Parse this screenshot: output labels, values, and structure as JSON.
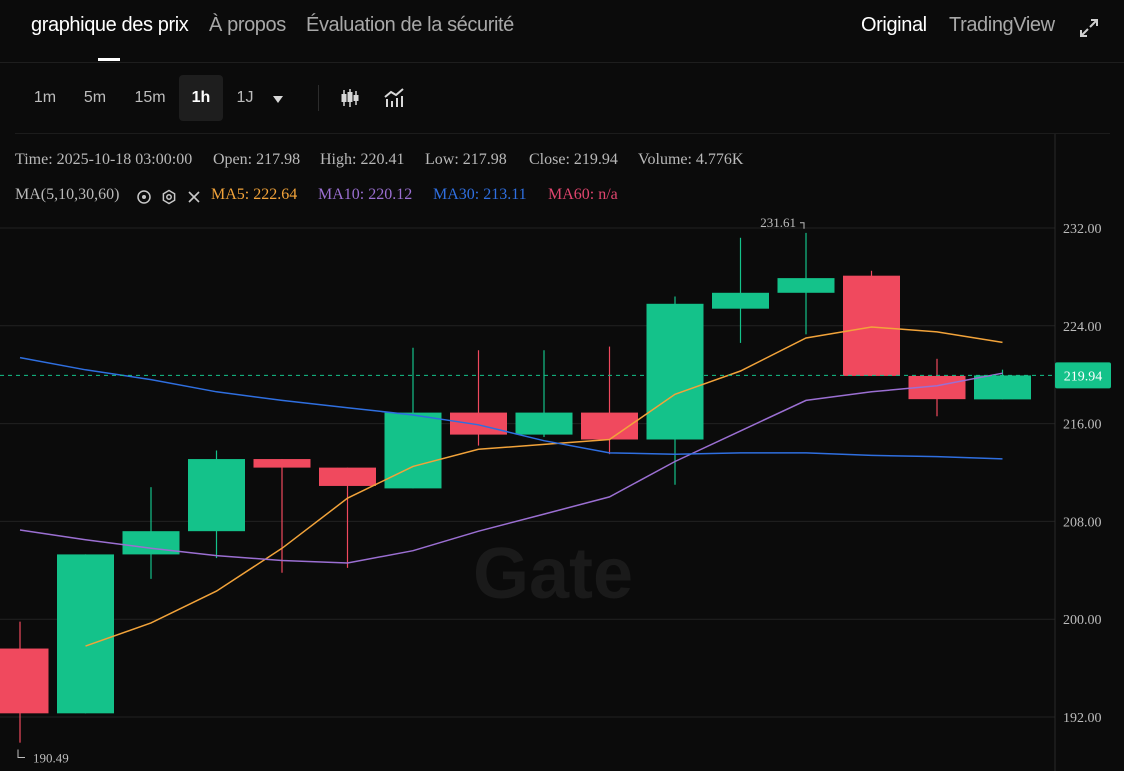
{
  "tabs": {
    "price_chart": "graphique des prix",
    "about": "À propos",
    "security": "Évaluation de la sécurité"
  },
  "source_toggle": {
    "original": "Original",
    "tradingview": "TradingView"
  },
  "toolbar": {
    "timeframes": [
      "1m",
      "5m",
      "15m",
      "1h",
      "1J"
    ],
    "active_timeframe": "1h"
  },
  "info_bar": {
    "time": "Time: 2025-10-18 03:00:00",
    "open": "Open: 217.98",
    "high": "High: 220.41",
    "low": "Low: 217.98",
    "close": "Close: 219.94",
    "volume": "Volume: 4.776K"
  },
  "ma_bar": {
    "label": "MA(5,10,30,60)",
    "ma5": "MA5: 222.64",
    "ma10": "MA10: 220.12",
    "ma30": "MA30: 213.11",
    "ma60": "MA60: n/a"
  },
  "colors": {
    "background": "#0b0b0b",
    "up": "#14c28a",
    "down": "#f0495e",
    "ma5": "#f2a33a",
    "ma10": "#9b6fd2",
    "ma30": "#2f6fe0",
    "ma60": "#e0456e",
    "grid": "#222222",
    "axis_text": "#bcbcbc"
  },
  "watermark": "Gate",
  "chart_data": {
    "type": "candlestick",
    "y_axis_side": "right",
    "ylim": [
      184,
      238.3
    ],
    "y_ticks": [
      "232.00",
      "224.00",
      "216.00",
      "208.00",
      "200.00",
      "192.00"
    ],
    "last_price": "219.94",
    "candles": [
      {
        "open": 197.6,
        "high": 199.8,
        "low": 189.9,
        "close": 192.3
      },
      {
        "open": 192.3,
        "high": 205.3,
        "low": 192.3,
        "close": 205.3
      },
      {
        "open": 205.3,
        "high": 210.8,
        "low": 203.3,
        "close": 207.2
      },
      {
        "open": 207.2,
        "high": 213.8,
        "low": 205.0,
        "close": 213.1
      },
      {
        "open": 213.1,
        "high": 213.1,
        "low": 203.8,
        "close": 212.4
      },
      {
        "open": 212.4,
        "high": 212.4,
        "low": 204.2,
        "close": 210.9
      },
      {
        "open": 210.7,
        "high": 222.2,
        "low": 210.7,
        "close": 216.9
      },
      {
        "open": 216.9,
        "high": 222.0,
        "low": 214.2,
        "close": 215.1
      },
      {
        "open": 215.1,
        "high": 222.0,
        "low": 214.9,
        "close": 216.9
      },
      {
        "open": 216.9,
        "high": 222.3,
        "low": 213.5,
        "close": 214.7
      },
      {
        "open": 214.7,
        "high": 226.4,
        "low": 211.0,
        "close": 225.8
      },
      {
        "open": 225.4,
        "high": 231.2,
        "low": 222.6,
        "close": 226.7
      },
      {
        "open": 226.7,
        "high": 231.6,
        "low": 223.3,
        "close": 227.9
      },
      {
        "open": 228.1,
        "high": 228.5,
        "low": 219.9,
        "close": 219.9
      },
      {
        "open": 219.9,
        "high": 221.3,
        "low": 216.6,
        "close": 218.0
      },
      {
        "open": 217.98,
        "high": 220.41,
        "low": 217.98,
        "close": 219.94
      }
    ],
    "ma_lines": [
      {
        "name": "MA5",
        "color": "#f2a33a",
        "values": [
          null,
          197.8,
          199.7,
          202.3,
          205.8,
          209.9,
          212.5,
          213.9,
          214.3,
          214.7,
          218.4,
          220.3,
          223.0,
          223.9,
          223.5,
          222.64
        ]
      },
      {
        "name": "MA10",
        "color": "#9b6fd2",
        "values": [
          207.3,
          206.5,
          205.8,
          205.2,
          204.8,
          204.6,
          205.6,
          207.2,
          208.6,
          210.0,
          212.9,
          215.4,
          217.9,
          218.6,
          219.1,
          220.12
        ]
      },
      {
        "name": "MA30",
        "color": "#2f6fe0",
        "values": [
          221.4,
          220.4,
          219.6,
          218.6,
          217.9,
          217.3,
          216.7,
          215.9,
          214.6,
          213.6,
          213.5,
          213.6,
          213.6,
          213.4,
          213.3,
          213.11
        ]
      }
    ],
    "annotations": [
      {
        "label": "231.61",
        "value": 231.61,
        "candle": 12
      },
      {
        "label": "190.49",
        "value": 190.49,
        "candle": 0
      }
    ]
  }
}
